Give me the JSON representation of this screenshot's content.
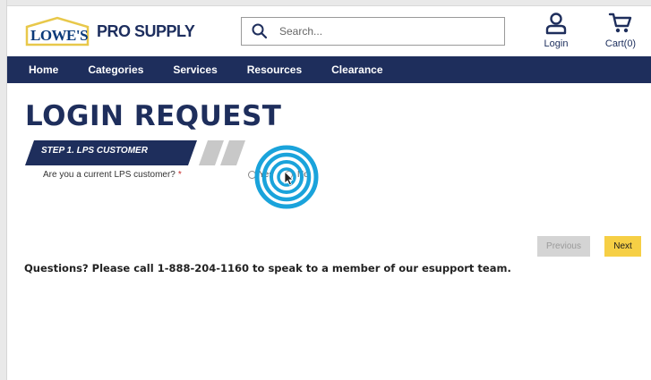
{
  "header": {
    "logo_word": "LOWE'S",
    "logo_tagline": "PRO SUPPLY",
    "search_placeholder": "Search...",
    "login_label": "Login",
    "cart_label": "Cart(0)"
  },
  "nav": {
    "items": [
      "Home",
      "Categories",
      "Services",
      "Resources",
      "Clearance"
    ]
  },
  "main": {
    "title": "LOGIN REQUEST",
    "step_label": "STEP 1. LPS CUSTOMER",
    "question": "Are you a current LPS customer?",
    "required_mark": "*",
    "option_yes": "Yes",
    "option_no": "No",
    "previous_label": "Previous",
    "next_label": "Next",
    "help_text": "Questions? Please call 1-888-204-1160 to speak to a member of our esupport team."
  },
  "colors": {
    "brand_navy": "#1e2e5c",
    "accent_yellow": "#f6cf45",
    "click_ring": "#1aa3db"
  }
}
